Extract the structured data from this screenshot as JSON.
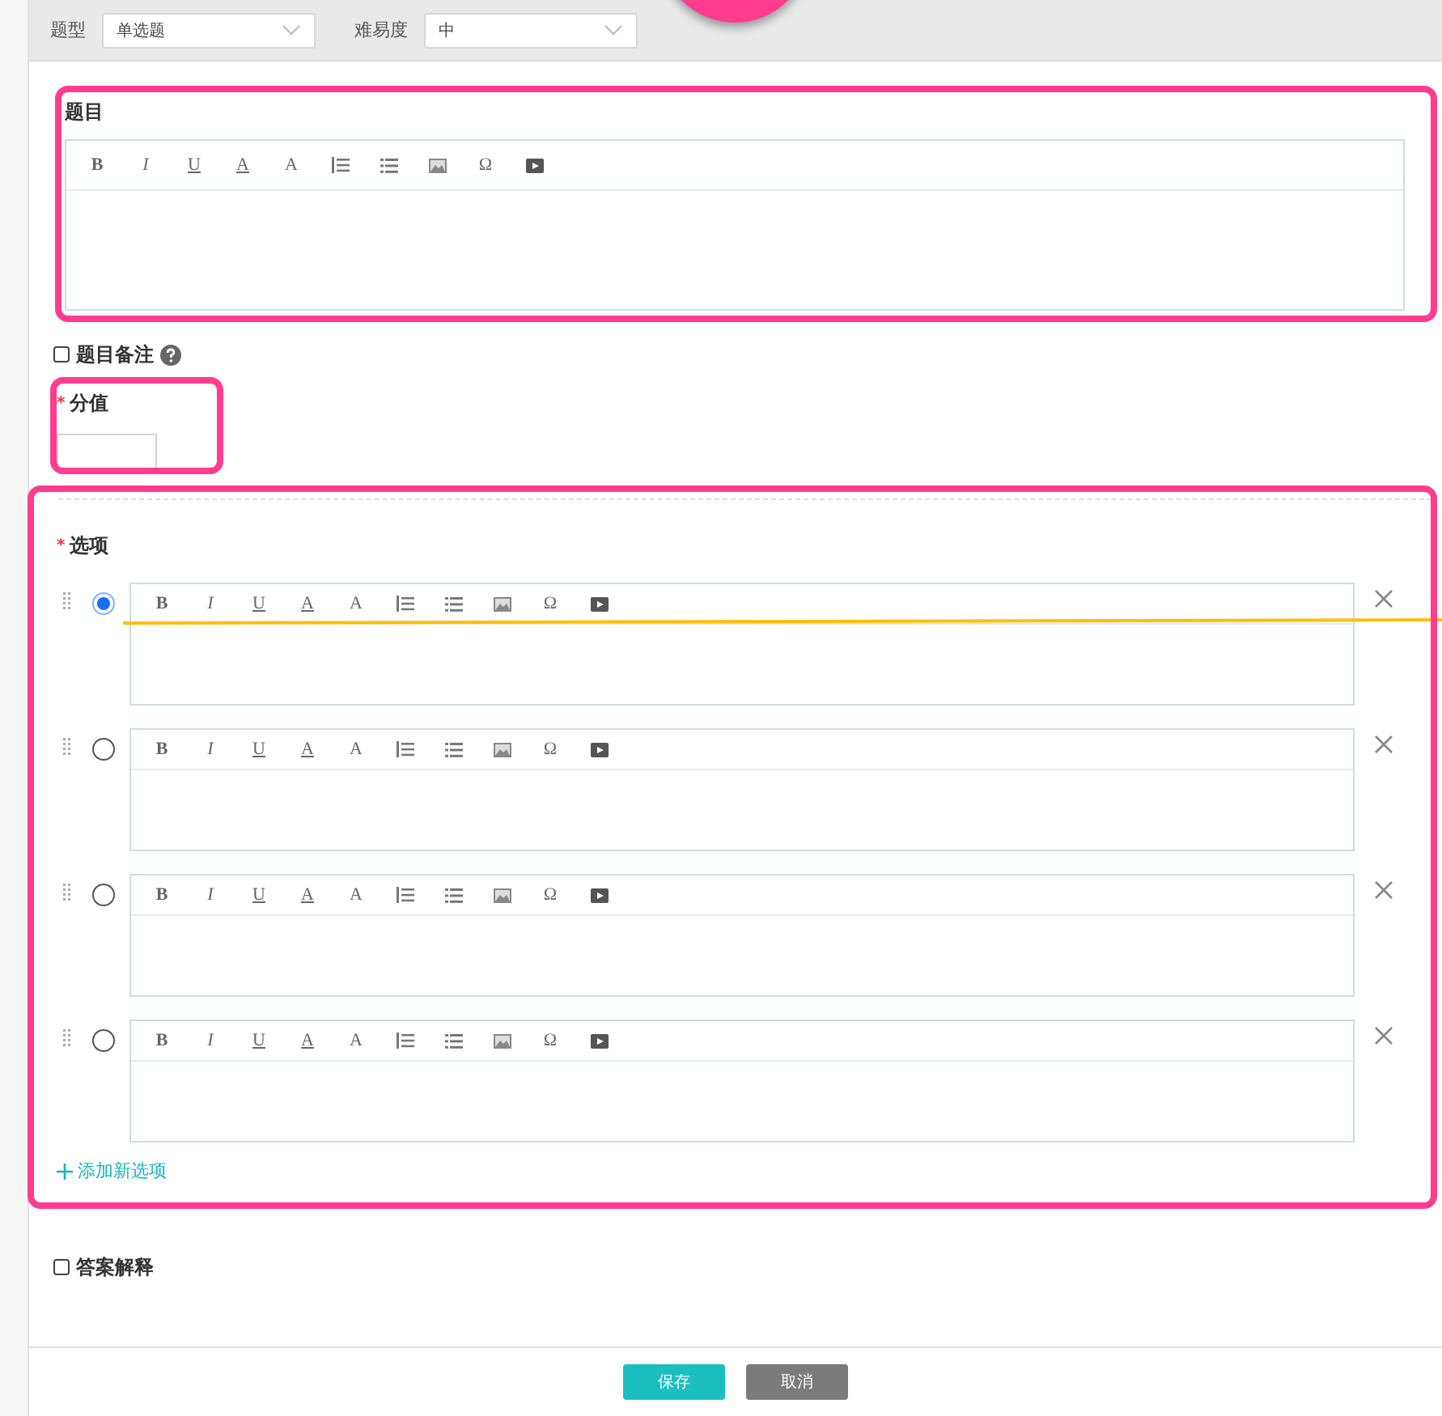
{
  "marker": {
    "kind": "circle"
  },
  "filters": [
    {
      "label": "题型",
      "value": "单选题"
    },
    {
      "label": "难易度",
      "value": "中"
    }
  ],
  "question": {
    "label": "题目",
    "highlighted": true,
    "toolbar": [
      {
        "kind": "bold",
        "label": "B"
      },
      {
        "kind": "italic",
        "label": "I"
      },
      {
        "kind": "underline",
        "label": "U"
      },
      {
        "kind": "font-color",
        "label": "A"
      },
      {
        "kind": "font-size",
        "label": "A"
      },
      {
        "kind": "ordered-list"
      },
      {
        "kind": "bullet-list"
      },
      {
        "kind": "image"
      },
      {
        "kind": "symbol",
        "label": "Ω"
      },
      {
        "kind": "video"
      }
    ]
  },
  "note": {
    "label": "题目备注",
    "checked": false,
    "help": true
  },
  "score": {
    "label": "分值",
    "required_mark": "*",
    "highlighted": true
  },
  "options": {
    "label": "选项",
    "required_mark": "*",
    "highlighted": true,
    "add_label": "添加新选项",
    "items": [
      {
        "selected": true,
        "marked": true,
        "toolbar": [
          {
            "kind": "bold",
            "label": "B"
          },
          {
            "kind": "italic",
            "label": "I"
          },
          {
            "kind": "underline",
            "label": "U"
          },
          {
            "kind": "font-color",
            "label": "A"
          },
          {
            "kind": "font-size",
            "label": "A"
          },
          {
            "kind": "ordered-list"
          },
          {
            "kind": "bullet-list"
          },
          {
            "kind": "image"
          },
          {
            "kind": "symbol",
            "label": "Ω"
          },
          {
            "kind": "video"
          }
        ]
      },
      {
        "selected": false,
        "marked": false,
        "toolbar": [
          {
            "kind": "bold",
            "label": "B"
          },
          {
            "kind": "italic",
            "label": "I"
          },
          {
            "kind": "underline",
            "label": "U"
          },
          {
            "kind": "font-color",
            "label": "A"
          },
          {
            "kind": "font-size",
            "label": "A"
          },
          {
            "kind": "ordered-list"
          },
          {
            "kind": "bullet-list"
          },
          {
            "kind": "image"
          },
          {
            "kind": "symbol",
            "label": "Ω"
          },
          {
            "kind": "video"
          }
        ]
      },
      {
        "selected": false,
        "marked": false,
        "toolbar": [
          {
            "kind": "bold",
            "label": "B"
          },
          {
            "kind": "italic",
            "label": "I"
          },
          {
            "kind": "underline",
            "label": "U"
          },
          {
            "kind": "font-color",
            "label": "A"
          },
          {
            "kind": "font-size",
            "label": "A"
          },
          {
            "kind": "ordered-list"
          },
          {
            "kind": "bullet-list"
          },
          {
            "kind": "image"
          },
          {
            "kind": "symbol",
            "label": "Ω"
          },
          {
            "kind": "video"
          }
        ]
      },
      {
        "selected": false,
        "marked": false,
        "toolbar": [
          {
            "kind": "bold",
            "label": "B"
          },
          {
            "kind": "italic",
            "label": "I"
          },
          {
            "kind": "underline",
            "label": "U"
          },
          {
            "kind": "font-color",
            "label": "A"
          },
          {
            "kind": "font-size",
            "label": "A"
          },
          {
            "kind": "ordered-list"
          },
          {
            "kind": "bullet-list"
          },
          {
            "kind": "image"
          },
          {
            "kind": "symbol",
            "label": "Ω"
          },
          {
            "kind": "video"
          }
        ]
      }
    ]
  },
  "explanation": {
    "label": "答案解释",
    "checked": false
  },
  "buttons": [
    {
      "kind": "primary",
      "label": "保存"
    },
    {
      "kind": "secondary",
      "label": "取消"
    }
  ]
}
